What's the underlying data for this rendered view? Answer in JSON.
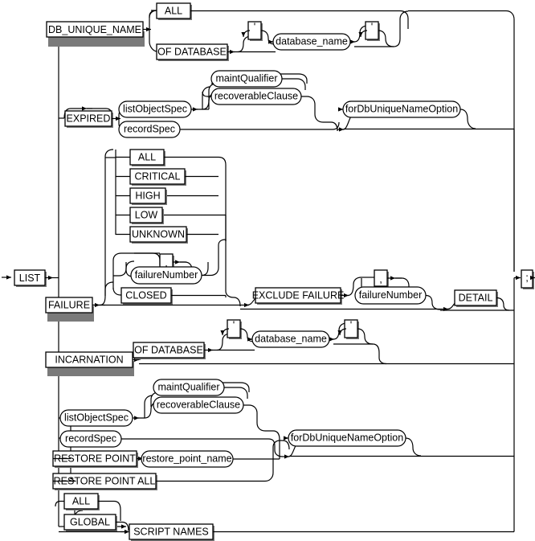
{
  "diagram": {
    "title": "list",
    "type": "railroad-syntax-diagram",
    "colors": {
      "background": "#ffffff",
      "line": "#000000",
      "box_fill": "#ffffff",
      "shadow": "#7a7a7a"
    },
    "start_keyword": "LIST",
    "end_terminator": ";",
    "punctuation": {
      "comma": ",",
      "quote": "'"
    },
    "branches": [
      {
        "id": "db-unique-name",
        "keyword": "DB_UNIQUE_NAME",
        "options": [
          "ALL",
          "OF DATABASE"
        ],
        "nonterminals": [
          "database_name"
        ]
      },
      {
        "id": "expired",
        "keyword": "EXPIRED",
        "nonterminals": [
          "listObjectSpec",
          "recordSpec",
          "maintQualifier",
          "recoverableClause",
          "forDbUniqueNameOption"
        ]
      },
      {
        "id": "failure",
        "keyword": "FAILURE",
        "options": [
          "ALL",
          "CRITICAL",
          "HIGH",
          "LOW",
          "UNKNOWN",
          "CLOSED"
        ],
        "nonterminals": [
          "failureNumber"
        ],
        "suffix_keywords": [
          "EXCLUDE FAILURE",
          "DETAIL"
        ]
      },
      {
        "id": "incarnation",
        "keyword": "INCARNATION",
        "options": [
          "OF DATABASE"
        ],
        "nonterminals": [
          "database_name"
        ]
      },
      {
        "id": "objects",
        "nonterminals": [
          "listObjectSpec",
          "recordSpec",
          "maintQualifier",
          "recoverableClause",
          "forDbUniqueNameOption",
          "restore_point_name"
        ],
        "options": [
          "RESTORE POINT",
          "RESTORE POINT ALL"
        ]
      },
      {
        "id": "script-names",
        "options": [
          "ALL",
          "GLOBAL"
        ],
        "keyword": "SCRIPT NAMES"
      }
    ]
  },
  "nodes": {
    "list": "LIST",
    "db_unique_name": "DB_UNIQUE_NAME",
    "all_1": "ALL",
    "of_database_1": "OF DATABASE",
    "quote_1": "'",
    "database_name_1": "database_name",
    "quote_2": "'",
    "expired": "EXPIRED",
    "list_object_spec_1": "listObjectSpec",
    "record_spec_1": "recordSpec",
    "maint_qualifier_1": "maintQualifier",
    "recoverable_clause_1": "recoverableClause",
    "for_db_unique_name_option_1": "forDbUniqueNameOption",
    "failure": "FAILURE",
    "f_all": "ALL",
    "f_critical": "CRITICAL",
    "f_high": "HIGH",
    "f_low": "LOW",
    "f_unknown": "UNKNOWN",
    "f_comma": ",",
    "failure_number_1": "failureNumber",
    "f_closed": "CLOSED",
    "exclude_failure": "EXCLUDE FAILURE",
    "ex_comma": ",",
    "failure_number_2": "failureNumber",
    "detail": "DETAIL",
    "semicolon": ";",
    "incarnation": "INCARNATION",
    "of_database_2": "OF DATABASE",
    "quote_3": "'",
    "database_name_2": "database_name",
    "quote_4": "'",
    "maint_qualifier_2": "maintQualifier",
    "recoverable_clause_2": "recoverableClause",
    "list_object_spec_2": "listObjectSpec",
    "record_spec_2": "recordSpec",
    "for_db_unique_name_option_2": "forDbUniqueNameOption",
    "restore_point": "RESTORE POINT",
    "restore_point_name": "restore_point_name",
    "restore_point_all": "RESTORE POINT ALL",
    "s_all": "ALL",
    "s_global": "GLOBAL",
    "script_names": "SCRIPT NAMES"
  }
}
